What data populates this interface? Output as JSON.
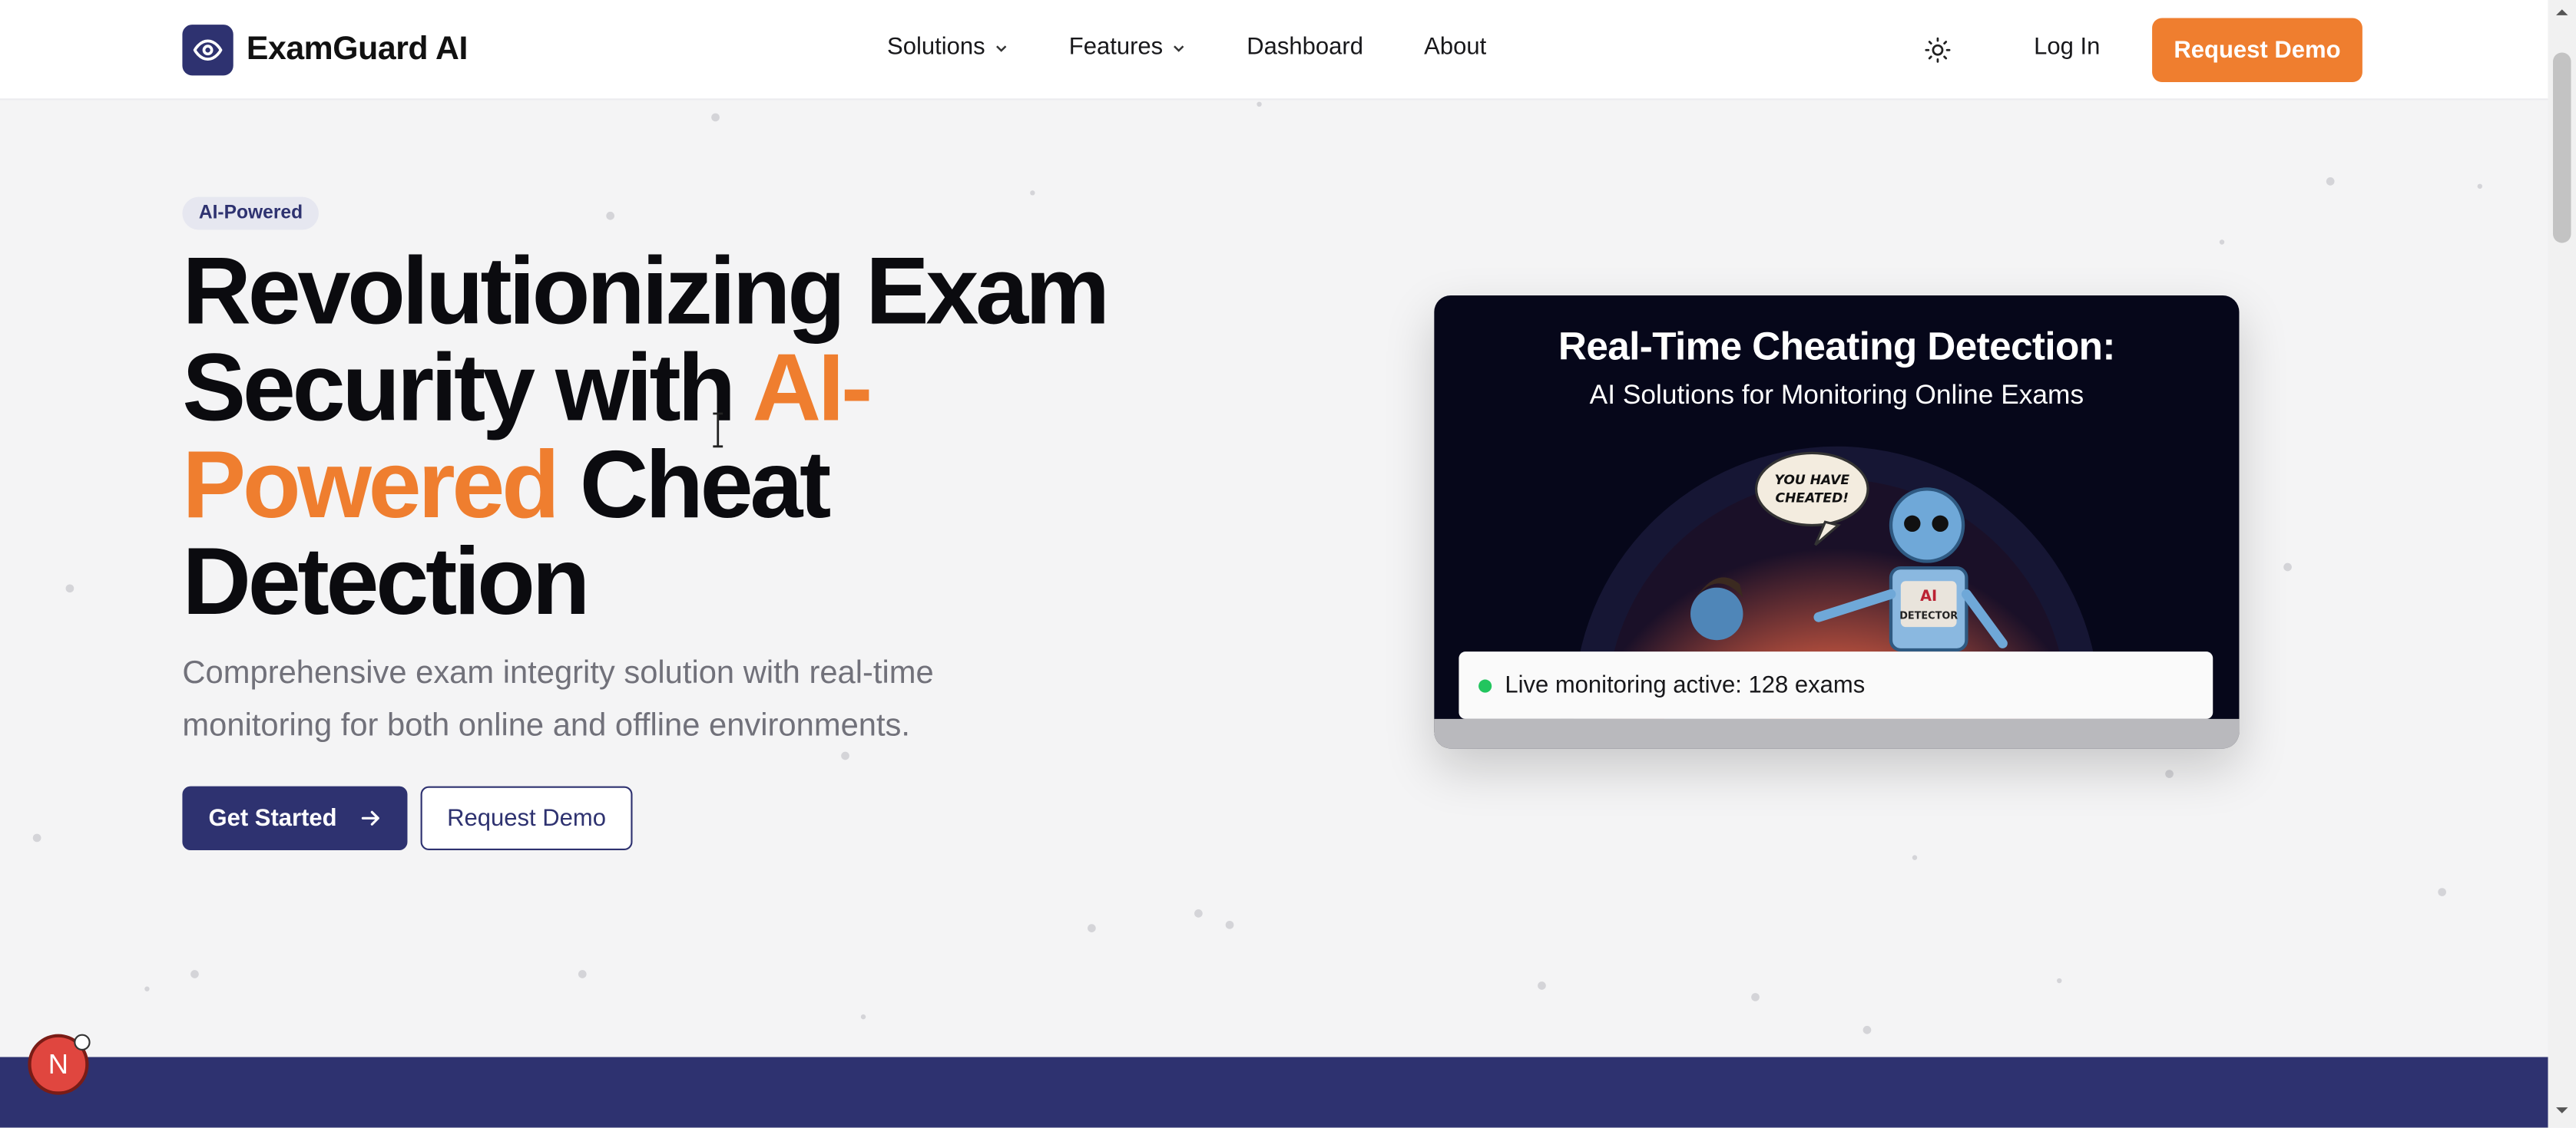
{
  "brand": {
    "name": "ExamGuard AI",
    "logo_icon": "eye-icon",
    "primary_color": "#2e3270",
    "accent_color": "#ef7e2f"
  },
  "nav": {
    "items": [
      {
        "label": "Solutions",
        "has_dropdown": true
      },
      {
        "label": "Features",
        "has_dropdown": true
      },
      {
        "label": "Dashboard",
        "has_dropdown": false
      },
      {
        "label": "About",
        "has_dropdown": false
      }
    ],
    "theme_icon": "sun-icon",
    "login_label": "Log In",
    "cta_label": "Request Demo"
  },
  "hero": {
    "badge": "AI-Powered",
    "headline_part1": "Revolutionizing Exam Security with ",
    "headline_accent": "AI-Powered",
    "headline_part2": " Cheat Detection",
    "subtext": "Comprehensive exam integrity solution with real-time monitoring for both online and offline environments.",
    "primary_button": "Get Started",
    "secondary_button": "Request Demo"
  },
  "card": {
    "title": "Real-Time Cheating Detection:",
    "subtitle": "AI Solutions for Monitoring Online Exams",
    "speech_bubble": "YOU HAVE CHEATED!",
    "robot_label": "AI DETECTOR",
    "live_status": "Live monitoring active: 128 exams",
    "live_color": "#22c55e"
  },
  "floating_badge": {
    "letter": "N"
  }
}
